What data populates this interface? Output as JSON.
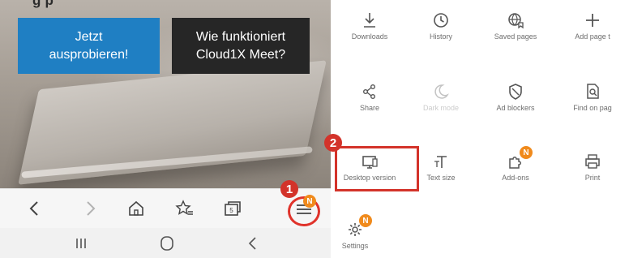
{
  "colors": {
    "cta_blue": "#1f7fc3",
    "cta_dark": "#262626",
    "annotation_red": "#d3332a",
    "notification_orange": "#f08a1c"
  },
  "hero": {
    "top_text": "g                  p",
    "cta_try": "Jetzt\nausprobieren!",
    "cta_how": "Wie funktioniert\nCloud1X Meet?"
  },
  "navbar": {
    "items": [
      {
        "icon": "back-icon"
      },
      {
        "icon": "forward-icon"
      },
      {
        "icon": "home-icon"
      },
      {
        "icon": "bookmark-add-icon"
      },
      {
        "icon": "tabs-icon"
      },
      {
        "icon": "menu-icon",
        "badge": "N"
      }
    ]
  },
  "sysbar": {
    "items": [
      {
        "icon": "recent-apps-icon"
      },
      {
        "icon": "home-circle-icon"
      },
      {
        "icon": "system-back-icon"
      }
    ]
  },
  "annotations": {
    "step1": "1",
    "step2": "2"
  },
  "menu": {
    "items": [
      {
        "label": "Downloads",
        "icon": "download-icon"
      },
      {
        "label": "History",
        "icon": "history-icon"
      },
      {
        "label": "Saved pages",
        "icon": "saved-pages-icon"
      },
      {
        "label": "Add page t",
        "icon": "plus-icon"
      },
      {
        "label": "Share",
        "icon": "share-icon"
      },
      {
        "label": "Dark mode",
        "icon": "dark-mode-icon",
        "disabled": true
      },
      {
        "label": "Ad blockers",
        "icon": "shield-icon"
      },
      {
        "label": "Find on pag",
        "icon": "find-on-page-icon"
      },
      {
        "label": "Desktop version",
        "icon": "desktop-icon",
        "highlighted": true
      },
      {
        "label": "Text size",
        "icon": "text-size-icon"
      },
      {
        "label": "Add-ons",
        "icon": "add-ons-icon",
        "badge": "N"
      },
      {
        "label": "Print",
        "icon": "print-icon"
      },
      {
        "label": "Settings",
        "icon": "settings-icon",
        "badge": "N"
      }
    ]
  }
}
